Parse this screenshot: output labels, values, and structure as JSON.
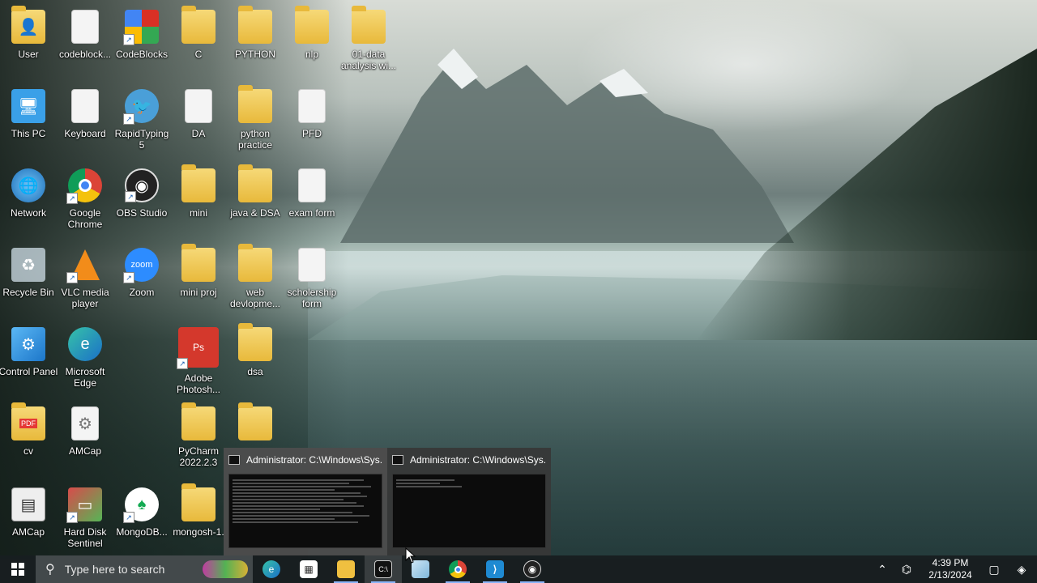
{
  "desktop": {
    "icons": [
      {
        "label": "User",
        "icon": "user-folder-icon"
      },
      {
        "label": "codeblock...",
        "icon": "document-icon"
      },
      {
        "label": "CodeBlocks",
        "icon": "codeblocks-icon"
      },
      {
        "label": "C",
        "icon": "folder-icon"
      },
      {
        "label": "PYTHON",
        "icon": "folder-icon"
      },
      {
        "label": "nlp",
        "icon": "folder-icon"
      },
      {
        "label": "01-data analysis wi...",
        "icon": "folder-icon"
      },
      {
        "label": "This PC",
        "icon": "this-pc-icon"
      },
      {
        "label": "Keyboard",
        "icon": "keyboard-doc-icon"
      },
      {
        "label": "RapidTyping 5",
        "icon": "rapidtyping-icon"
      },
      {
        "label": "DA",
        "icon": "document-icon"
      },
      {
        "label": "python practice",
        "icon": "folder-icon"
      },
      {
        "label": "PFD",
        "icon": "document-icon"
      },
      {
        "label": "Network",
        "icon": "network-icon"
      },
      {
        "label": "Google Chrome",
        "icon": "chrome-icon"
      },
      {
        "label": "OBS Studio",
        "icon": "obs-icon"
      },
      {
        "label": "mini",
        "icon": "folder-icon"
      },
      {
        "label": "java & DSA",
        "icon": "folder-icon"
      },
      {
        "label": "exam form",
        "icon": "edge-document-icon"
      },
      {
        "label": "Recycle Bin",
        "icon": "recycle-bin-icon"
      },
      {
        "label": "VLC media player",
        "icon": "vlc-icon"
      },
      {
        "label": "Zoom",
        "icon": "zoom-icon"
      },
      {
        "label": "mini proj",
        "icon": "folder-icon"
      },
      {
        "label": "web devlopme...",
        "icon": "folder-icon"
      },
      {
        "label": "scholership form",
        "icon": "edge-document-icon"
      },
      {
        "label": "Control Panel",
        "icon": "control-panel-icon"
      },
      {
        "label": "Microsoft Edge",
        "icon": "edge-icon"
      },
      {
        "label": "Adobe Photosh...",
        "icon": "photoshop-icon"
      },
      {
        "label": "dsa",
        "icon": "folder-icon"
      },
      {
        "label": "cv",
        "icon": "pdf-folder-icon"
      },
      {
        "label": "AMCap",
        "icon": "amcap-icon"
      },
      {
        "label": "PyCharm 2022.2.3",
        "icon": "folder-icon"
      },
      {
        "label": "",
        "icon": "folder-icon"
      },
      {
        "label": "AMCap",
        "icon": "amcap-app-icon"
      },
      {
        "label": "Hard Disk Sentinel",
        "icon": "hard-disk-sentinel-icon"
      },
      {
        "label": "MongoDB...",
        "icon": "mongodb-icon"
      },
      {
        "label": "mongosh-1.",
        "icon": "folder-icon"
      }
    ]
  },
  "thumbnails": [
    {
      "title": "Administrator: C:\\Windows\\Sys..."
    },
    {
      "title": "Administrator: C:\\Windows\\Sys..."
    }
  ],
  "taskbar": {
    "search_placeholder": "Type here to search",
    "apps": [
      {
        "name": "edge-taskbar-icon"
      },
      {
        "name": "store-taskbar-icon"
      },
      {
        "name": "file-explorer-taskbar-icon"
      },
      {
        "name": "cmd-taskbar-icon"
      },
      {
        "name": "notepad-taskbar-icon"
      },
      {
        "name": "chrome-taskbar-icon"
      },
      {
        "name": "vscode-taskbar-icon"
      },
      {
        "name": "obs-taskbar-icon"
      }
    ],
    "time": "4:39 PM",
    "date": "2/13/2024"
  },
  "colors": {
    "taskbar": "#181e20",
    "folder": "#e8b93b",
    "accent": "#8ab4f8"
  }
}
